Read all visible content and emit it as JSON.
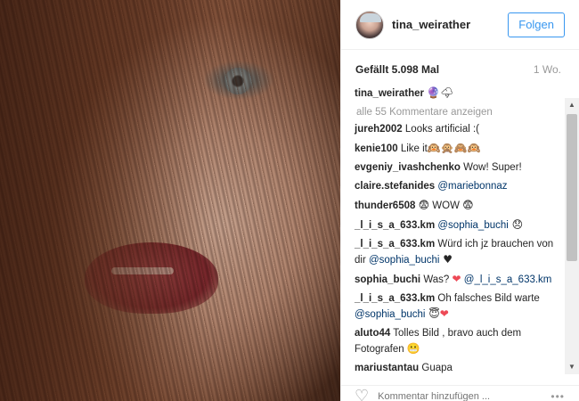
{
  "post": {
    "username": "tina_weirather",
    "follow_label": "Folgen",
    "likes_label": "Gefällt 5.098 Mal",
    "time_label": "1 Wo.",
    "caption_emojis": "🔮🌩",
    "all_comments_label": "alle 55 Kommentare anzeigen"
  },
  "comments": [
    {
      "user": "jureh2002",
      "parts": [
        {
          "type": "text",
          "value": "Looks artificial :("
        }
      ]
    },
    {
      "user": "kenie100",
      "parts": [
        {
          "type": "text",
          "value": "Like it"
        },
        {
          "type": "emoji",
          "value": "🙉🙊🙈🙉"
        }
      ]
    },
    {
      "user": "evgeniy_ivashchenko",
      "parts": [
        {
          "type": "text",
          "value": "Wow! Super!"
        }
      ]
    },
    {
      "user": "claire.stefanides",
      "parts": [
        {
          "type": "mention",
          "value": "@mariebonnaz"
        }
      ]
    },
    {
      "user": "thunder6508",
      "parts": [
        {
          "type": "emoji",
          "value": "😨"
        },
        {
          "type": "text",
          "value": " WOW "
        },
        {
          "type": "emoji",
          "value": "😨"
        }
      ]
    },
    {
      "user": "_l_i_s_a_633.km",
      "parts": [
        {
          "type": "mention",
          "value": "@sophia_buchi"
        },
        {
          "type": "emoji",
          "value": " 😞"
        }
      ]
    },
    {
      "user": "_l_i_s_a_633.km",
      "parts": [
        {
          "type": "text",
          "value": "Würd ich jz brauchen von dir "
        },
        {
          "type": "mention",
          "value": "@sophia_buchi"
        },
        {
          "type": "emoji",
          "value": " ♥"
        }
      ]
    },
    {
      "user": "sophia_buchi",
      "parts": [
        {
          "type": "text",
          "value": "Was? "
        },
        {
          "type": "heart",
          "value": "❤"
        },
        {
          "type": "text",
          "value": " "
        },
        {
          "type": "mention",
          "value": "@_l_i_s_a_633.km"
        }
      ]
    },
    {
      "user": "_l_i_s_a_633.km",
      "parts": [
        {
          "type": "text",
          "value": "Oh falsches Bild warte "
        },
        {
          "type": "mention",
          "value": "@sophia_buchi"
        },
        {
          "type": "emoji",
          "value": " 😇"
        },
        {
          "type": "heart",
          "value": "❤"
        }
      ]
    },
    {
      "user": "aluto44",
      "parts": [
        {
          "type": "text",
          "value": "Tolles Bild , bravo auch dem Fotografen "
        },
        {
          "type": "emoji",
          "value": "😬"
        }
      ]
    },
    {
      "user": "mariustantau",
      "parts": [
        {
          "type": "text",
          "value": "Guapa"
        }
      ]
    }
  ],
  "add_comment": {
    "placeholder": "Kommentar hinzufügen ..."
  },
  "more_label": "•••",
  "colors": {
    "accent": "#3897f0",
    "mention": "#003569",
    "heart": "#ed4956",
    "muted": "#999999"
  }
}
